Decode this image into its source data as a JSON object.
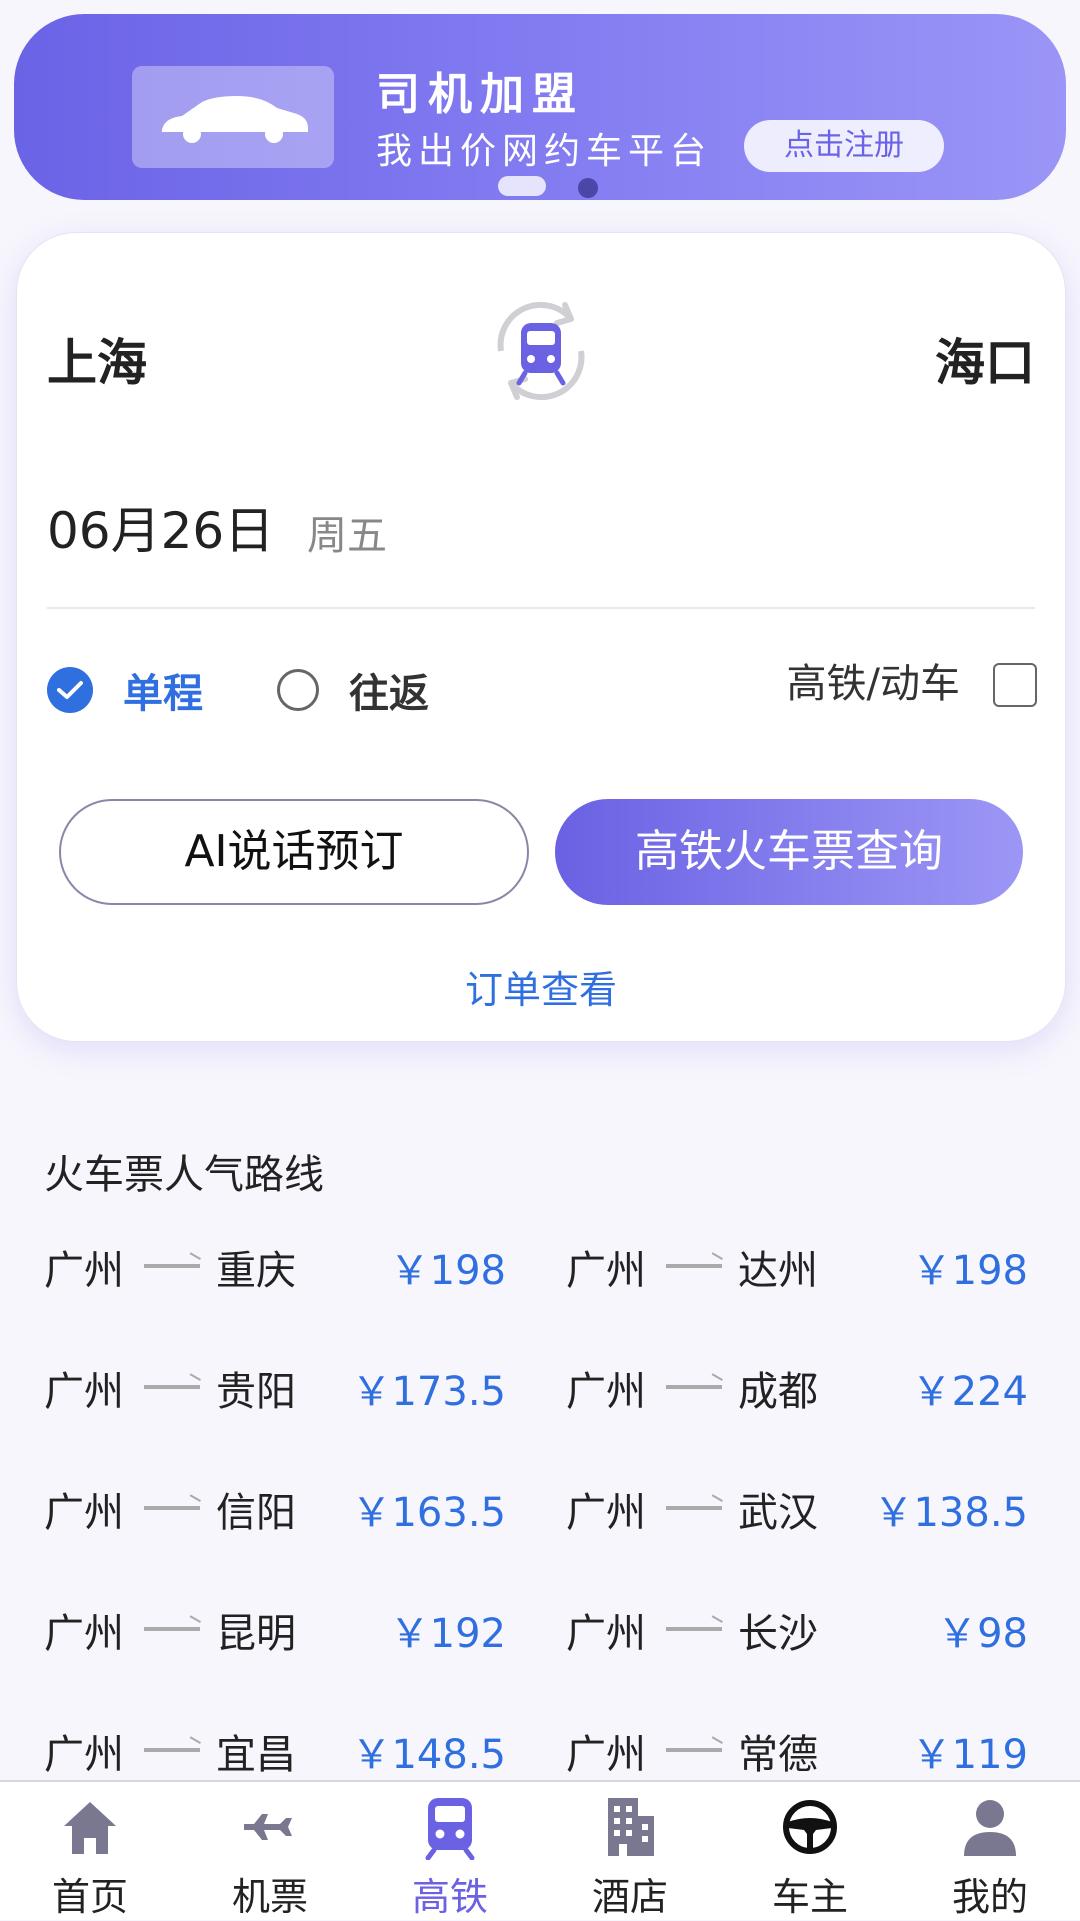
{
  "banner": {
    "title": "司机加盟",
    "subtitle": "我出价网约车平台",
    "button": "点击注册",
    "car_icon": "car-icon"
  },
  "search": {
    "from_city": "上海",
    "to_city": "海口",
    "date": "06月26日",
    "weekday": "周五",
    "trip_one_way": "单程",
    "trip_round": "往返",
    "trip_selected": "单程",
    "hsr_label": "高铁/动车",
    "hsr_checked": false,
    "ai_button": "AI说话预订",
    "search_button": "高铁火车票查询",
    "order_link": "订单查看"
  },
  "popular": {
    "title": "火车票人气路线",
    "routes": [
      {
        "from": "广州",
        "to": "重庆",
        "price": "￥198"
      },
      {
        "from": "广州",
        "to": "达州",
        "price": "￥198"
      },
      {
        "from": "广州",
        "to": "贵阳",
        "price": "￥173.5"
      },
      {
        "from": "广州",
        "to": "成都",
        "price": "￥224"
      },
      {
        "from": "广州",
        "to": "信阳",
        "price": "￥163.5"
      },
      {
        "from": "广州",
        "to": "武汉",
        "price": "￥138.5"
      },
      {
        "from": "广州",
        "to": "昆明",
        "price": "￥192"
      },
      {
        "from": "广州",
        "to": "长沙",
        "price": "￥98"
      },
      {
        "from": "广州",
        "to": "宜昌",
        "price": "￥148.5"
      },
      {
        "from": "广州",
        "to": "常德",
        "price": "￥119"
      }
    ]
  },
  "nav": {
    "items": [
      {
        "label": "首页",
        "icon": "home-icon"
      },
      {
        "label": "机票",
        "icon": "airplane-icon"
      },
      {
        "label": "高铁",
        "icon": "train-icon"
      },
      {
        "label": "酒店",
        "icon": "hotel-icon"
      },
      {
        "label": "车主",
        "icon": "steering-wheel-icon"
      },
      {
        "label": "我的",
        "icon": "user-icon"
      }
    ],
    "active": "高铁"
  },
  "colors": {
    "accent": "#6a61e3",
    "link_blue": "#2f6fe0",
    "nav_icon_gray": "#7a7890"
  }
}
